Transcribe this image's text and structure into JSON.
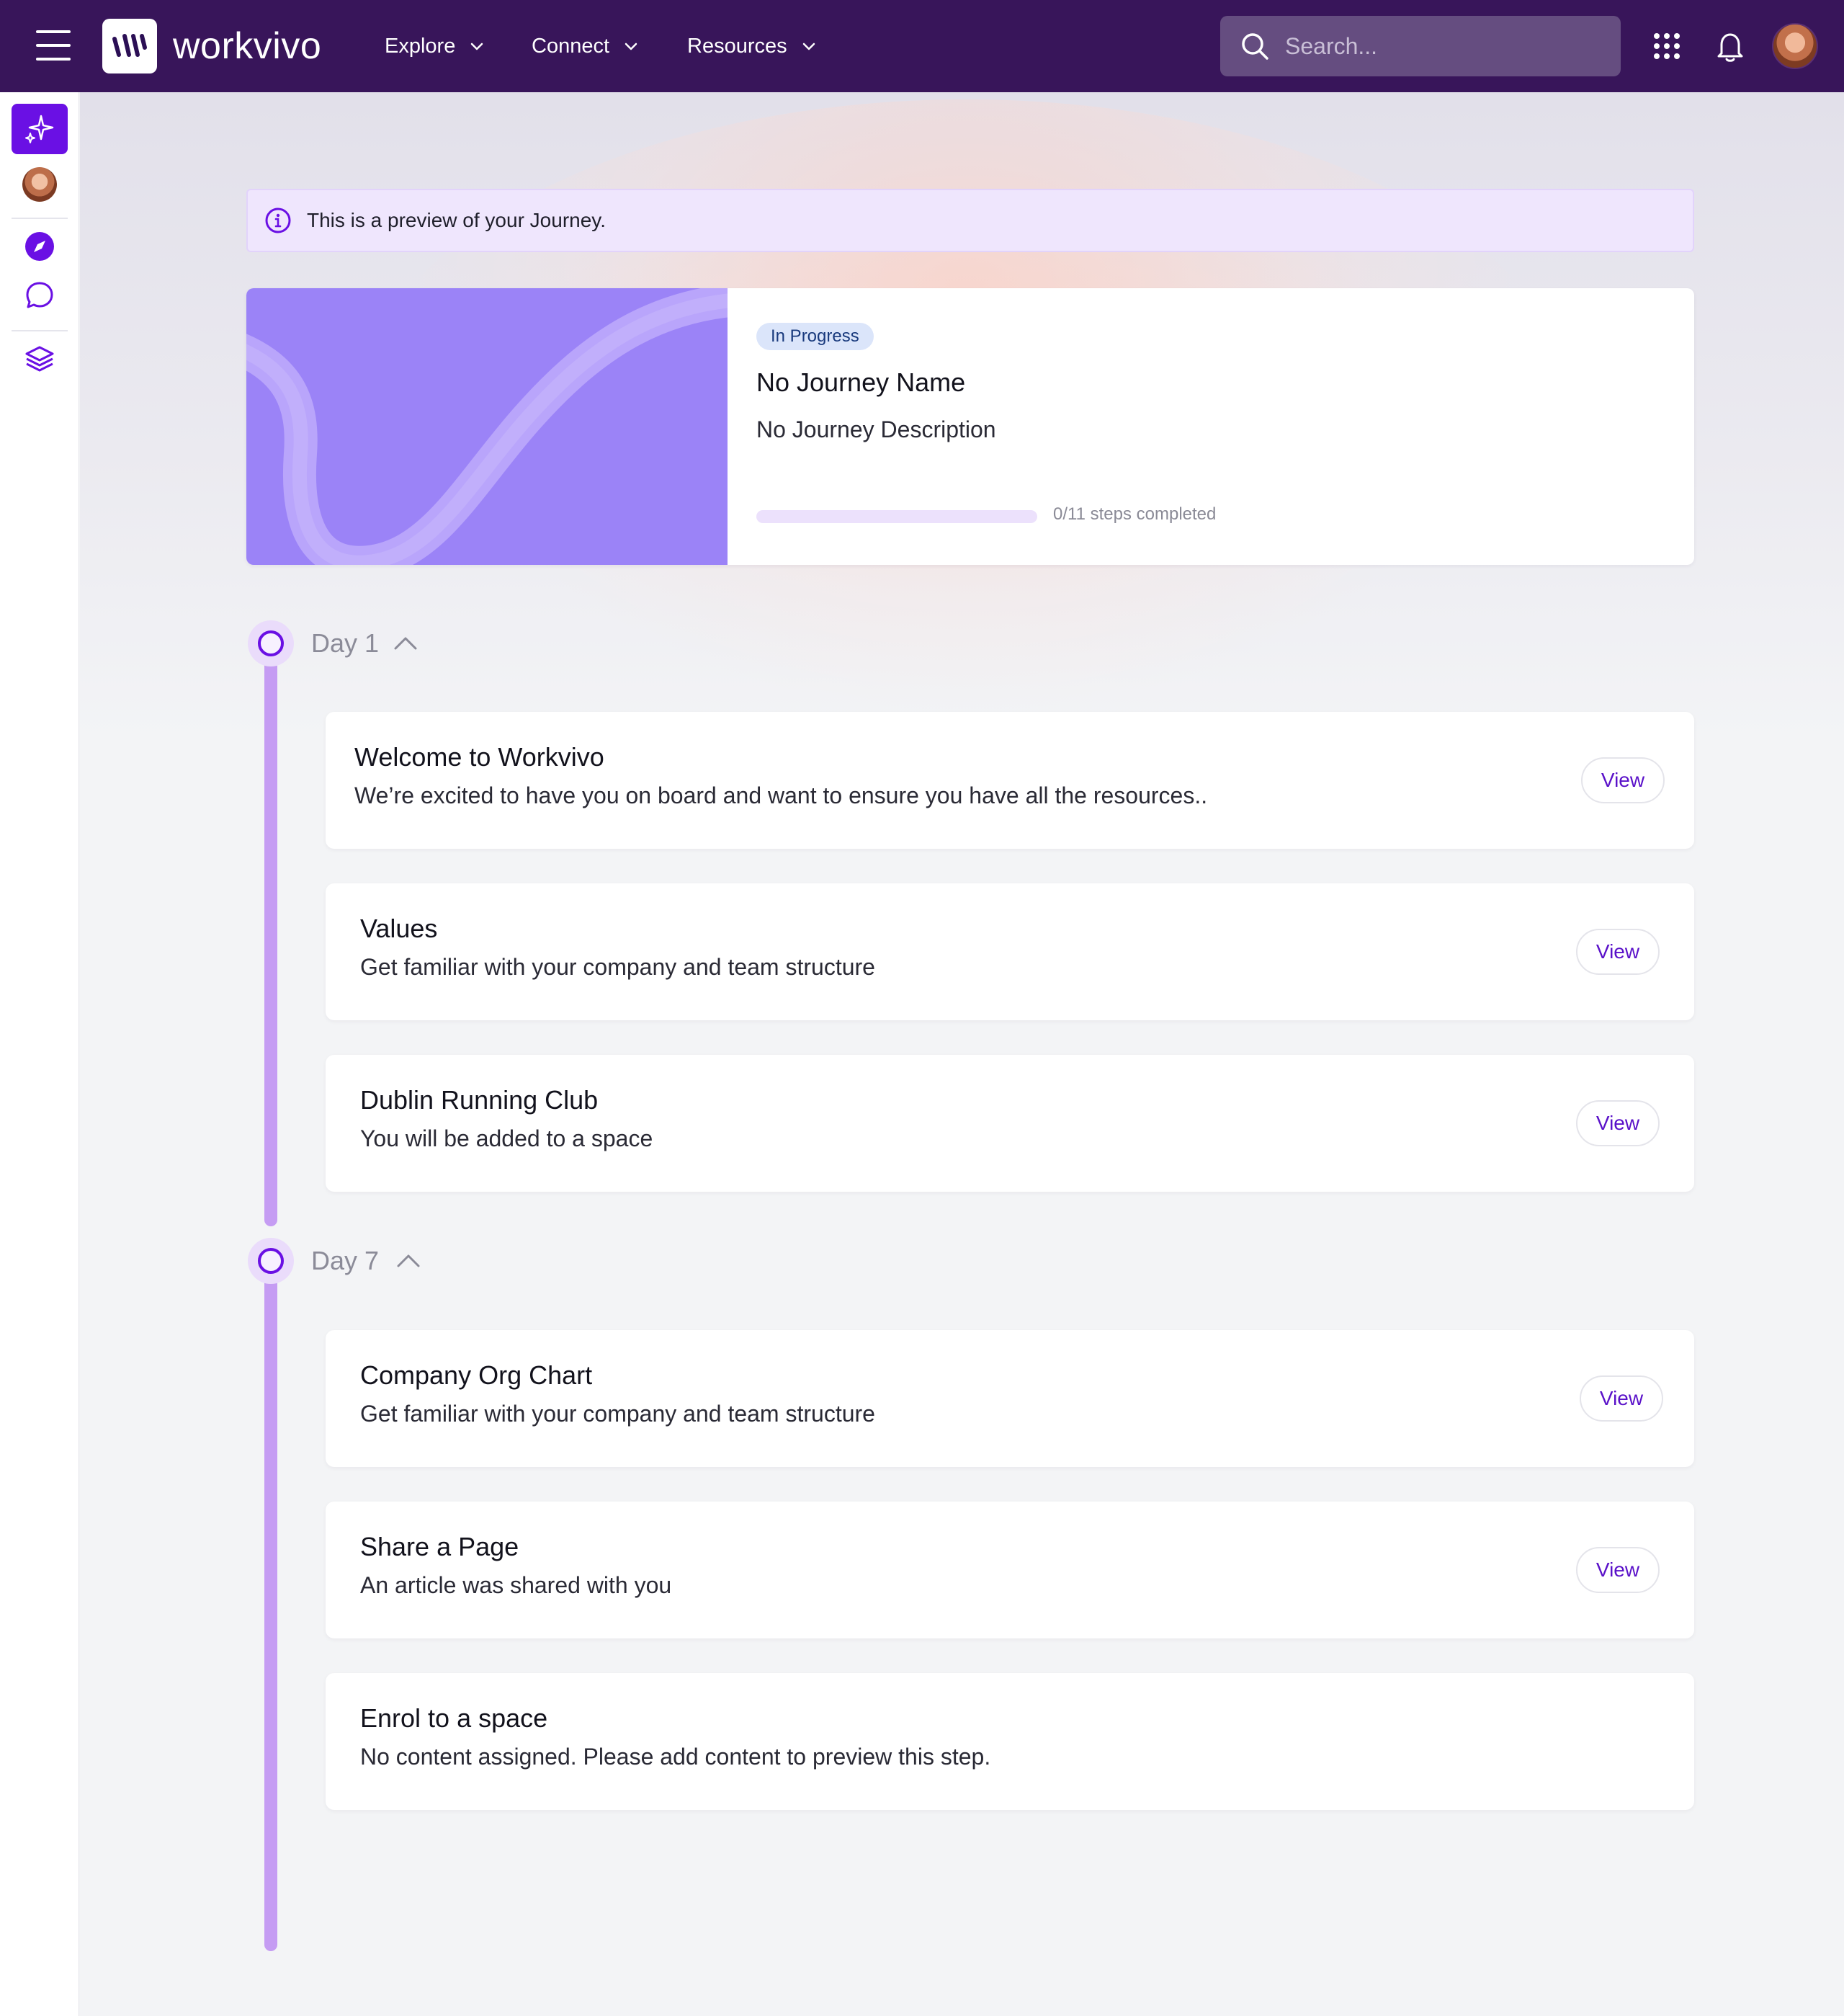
{
  "header": {
    "brand": "workvivo",
    "nav": [
      {
        "label": "Explore"
      },
      {
        "label": "Connect"
      },
      {
        "label": "Resources"
      }
    ],
    "search_placeholder": "Search..."
  },
  "banner": {
    "text": "This is a preview of your Journey."
  },
  "journey": {
    "status": "In Progress",
    "name": "No Journey Name",
    "description": "No Journey Description",
    "progress": {
      "completed": 0,
      "total": 11,
      "label": "0/11 steps completed"
    }
  },
  "days": [
    {
      "label": "Day 1",
      "steps": [
        {
          "title": "Welcome to Workvivo",
          "description": "We’re excited to have you on board and want to ensure you have all the resources..",
          "action": "View"
        },
        {
          "title": "Values",
          "description": "Get familiar with your company and team structure",
          "action": "View"
        },
        {
          "title": "Dublin Running Club",
          "description": "You will be added to a space",
          "action": "View"
        }
      ]
    },
    {
      "label": "Day 7",
      "steps": [
        {
          "title": "Company Org Chart",
          "description": "Get familiar with your company and team structure",
          "action": "View"
        },
        {
          "title": "Share a Page",
          "description": "An article was shared with you",
          "action": "View"
        },
        {
          "title": "Enrol to a space",
          "description": "No content assigned. Please add content to preview this step.",
          "action": ""
        }
      ]
    }
  ],
  "colors": {
    "topbar": "#38155a",
    "accent": "#6a10e4",
    "timeline": "#c59cf3",
    "journey_art": "#9b83f7",
    "badge_bg": "#dbe5fa"
  },
  "icons": {
    "rail": [
      "sparkles-icon",
      "avatar",
      "compass-icon",
      "chat-icon",
      "layers-icon"
    ],
    "header": [
      "menu-icon",
      "search-icon",
      "apps-grid-icon",
      "bell-icon",
      "avatar"
    ]
  }
}
